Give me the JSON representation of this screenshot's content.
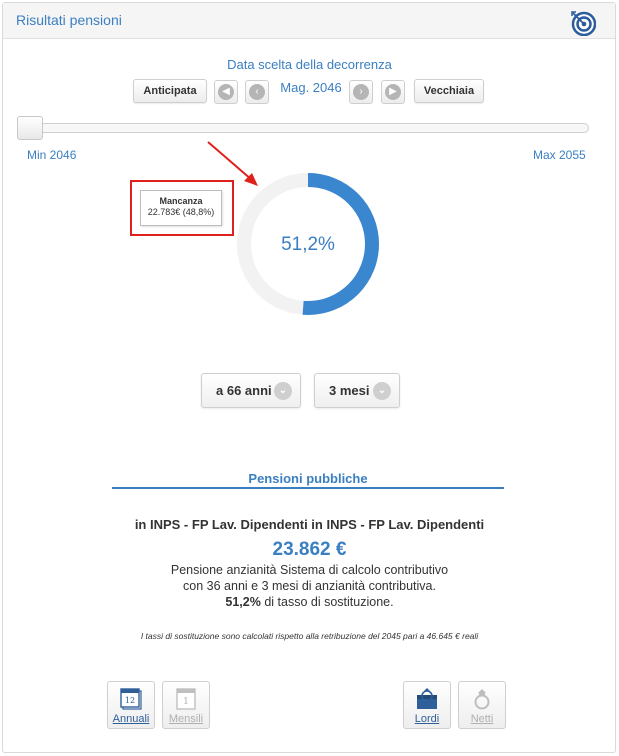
{
  "panel": {
    "title": "Risultati pensioni"
  },
  "decorrenza": {
    "label": "Data scelta della decorrenza",
    "anticipata_label": "Anticipata",
    "vecchiaia_label": "Vecchiaia",
    "selected_date": "Mag. 2046",
    "min_label": "Min 2046",
    "max_label": "Max 2055"
  },
  "donut": {
    "percent_label": "51,2%",
    "fill_fraction": 0.512,
    "fill_color": "#3a87cf",
    "track_color": "#f2f2f2"
  },
  "tooltip": {
    "title": "Mancanza",
    "text": "22.783€ (48,8%)"
  },
  "age_select": {
    "years": "a 66 anni",
    "months": "3 mesi"
  },
  "public_pensions": {
    "title": "Pensioni pubbliche",
    "fund_name": "in INPS - FP Lav. Dipendenti in INPS - FP Lav. Dipendenti",
    "amount": "23.862 €",
    "line1": "Pensione anzianità Sistema di calcolo contributivo",
    "line2": "con 36 anni e 3 mesi di anzianità contributiva.",
    "rate_bold": "51,2%",
    "rate_rest": " di tasso di sostituzione.",
    "note": "I tassi di sostituzione sono calcolati rispetto alla retribuzione del 2045 pari a 46.645 € reali"
  },
  "toggles": {
    "annuali": "Annuali",
    "annuali_num": "12",
    "mensili": "Mensili",
    "mensili_num": "1",
    "lordi": "Lordi",
    "netti": "Netti"
  },
  "colors": {
    "accent": "#3a7fc1",
    "highlight": "#e0201b"
  }
}
